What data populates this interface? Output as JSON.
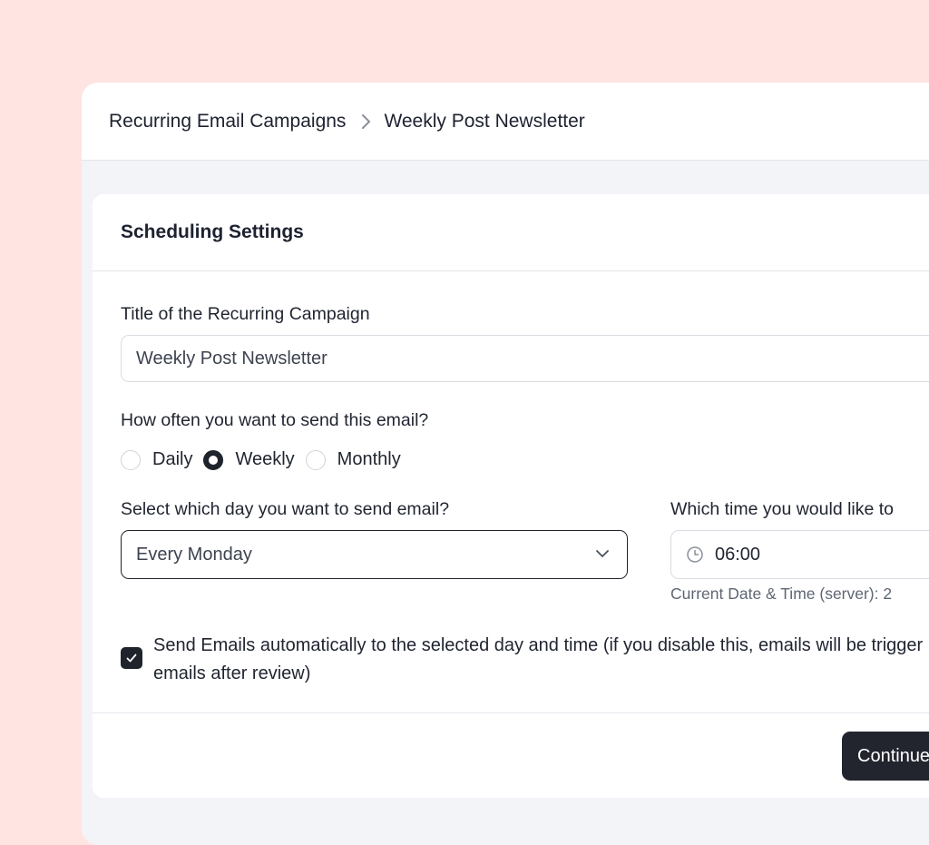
{
  "breadcrumb": {
    "parent": "Recurring Email Campaigns",
    "current": "Weekly Post Newsletter"
  },
  "card": {
    "title": "Scheduling Settings"
  },
  "form": {
    "title_label": "Title of the Recurring Campaign",
    "title_value": "Weekly Post Newsletter",
    "frequency_label": "How often you want to send this email?",
    "frequency_options": [
      {
        "label": "Daily",
        "checked": false
      },
      {
        "label": "Weekly",
        "checked": true
      },
      {
        "label": "Monthly",
        "checked": false
      }
    ],
    "day_label": "Select which day you want to send email?",
    "day_value": "Every Monday",
    "time_label": "Which time you would like to",
    "time_value": "06:00",
    "time_hint": "Current Date & Time (server): 2",
    "auto_send_checked": true,
    "auto_send_label": "Send Emails automatically to the selected day and time (if you disable this, emails will be trigger emails after review)"
  },
  "actions": {
    "continue_label": "Continue"
  },
  "icons": {
    "breadcrumb_separator": "chevron-right-icon",
    "select_chevron": "chevron-down-icon",
    "time": "clock-icon",
    "checkbox_mark": "check-icon"
  },
  "colors": {
    "page_background": "#ffe4e2",
    "primary_dark": "#22252e",
    "border": "#d9dce2"
  }
}
